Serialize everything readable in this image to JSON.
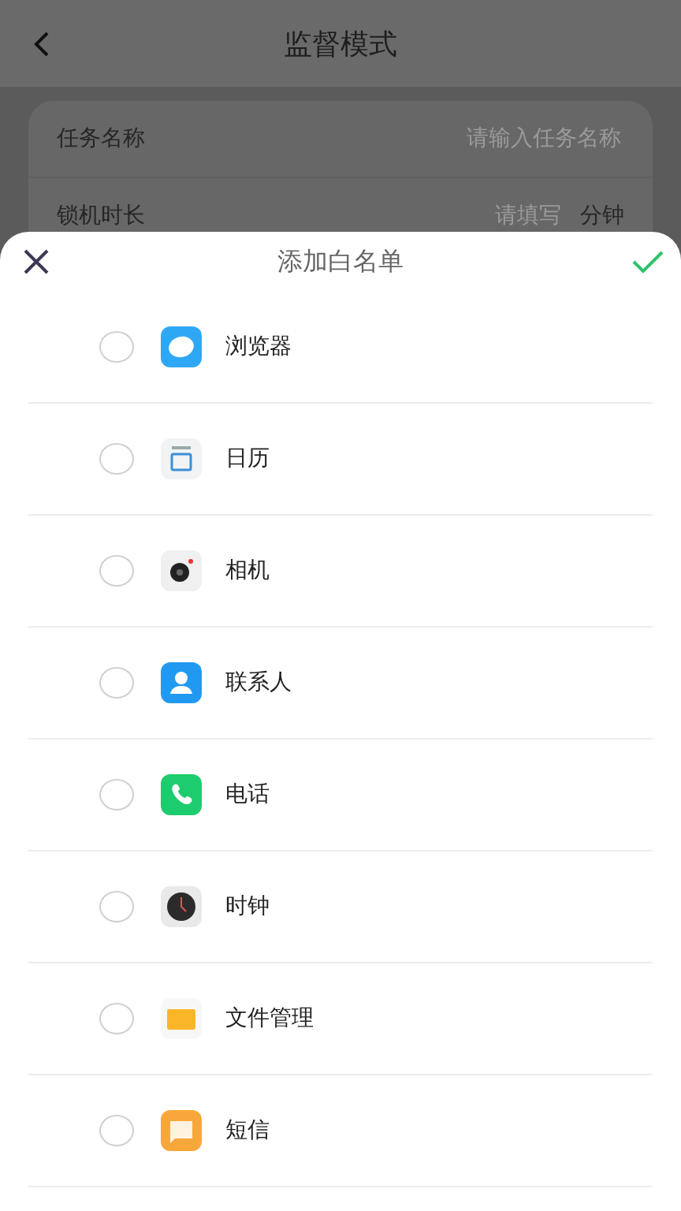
{
  "page": {
    "title": "监督模式",
    "form": [
      {
        "label": "任务名称",
        "placeholder": "请输入任务名称"
      },
      {
        "label": "锁机时长",
        "placeholder": "请填写",
        "unit": "分钟"
      }
    ]
  },
  "sheet": {
    "title": "添加白名单",
    "apps": [
      {
        "name": "浏览器",
        "kind": "browser",
        "selected": false
      },
      {
        "name": "日历",
        "kind": "calendar",
        "selected": false
      },
      {
        "name": "相机",
        "kind": "camera",
        "selected": false
      },
      {
        "name": "联系人",
        "kind": "contacts",
        "selected": false
      },
      {
        "name": "电话",
        "kind": "phone",
        "selected": false
      },
      {
        "name": "时钟",
        "kind": "clock",
        "selected": false
      },
      {
        "name": "文件管理",
        "kind": "files",
        "selected": false
      },
      {
        "name": "短信",
        "kind": "messages",
        "selected": false
      }
    ]
  }
}
